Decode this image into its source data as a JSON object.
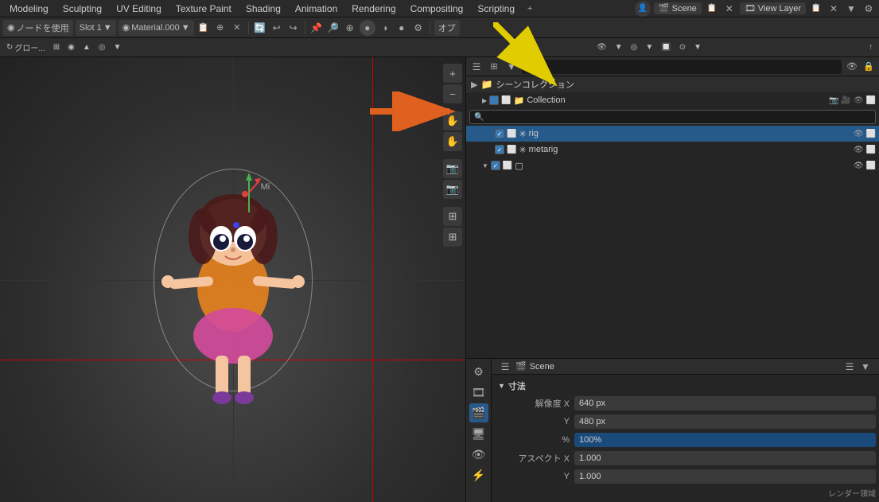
{
  "topMenu": {
    "items": [
      {
        "label": "Modeling",
        "id": "modeling"
      },
      {
        "label": "Sculpting",
        "id": "sculpting"
      },
      {
        "label": "UV Editing",
        "id": "uv-editing"
      },
      {
        "label": "Texture Paint",
        "id": "texture-paint"
      },
      {
        "label": "Shading",
        "id": "shading"
      },
      {
        "label": "Animation",
        "id": "animation"
      },
      {
        "label": "Rendering",
        "id": "rendering"
      },
      {
        "label": "Compositing",
        "id": "compositing"
      },
      {
        "label": "Scripting",
        "id": "scripting"
      }
    ],
    "plusLabel": "+",
    "scene": "Scene",
    "viewLayer": "View Layer"
  },
  "toolbar2": {
    "nodesLabel": "ノードを使用",
    "slotLabel": "Slot 1",
    "materialLabel": "Material.000",
    "opLabel": "オプ"
  },
  "toolbar3": {
    "glowLabel": "グロー...",
    "items": []
  },
  "outliner": {
    "sceneCollectionLabel": "シーンコレクション",
    "collectionLabel": "Collection",
    "searchPlaceholder": "",
    "items": [
      {
        "label": "rig",
        "indent": 2,
        "selected": true,
        "icon": "✳"
      },
      {
        "label": "metarig",
        "indent": 2,
        "selected": false,
        "icon": "✳"
      },
      {
        "label": "",
        "indent": 3,
        "selected": false,
        "icon": "▢"
      }
    ]
  },
  "properties": {
    "headerLabel": "Scene",
    "sectionLabel": "寸法",
    "fields": [
      {
        "label": "解像度 X",
        "value": "640 px",
        "isBlue": false
      },
      {
        "label": "Y",
        "value": "480 px",
        "isBlue": false
      },
      {
        "label": "%",
        "value": "100%",
        "isBlue": true
      },
      {
        "label": "アスペクト X",
        "value": "1.000",
        "isBlue": false
      },
      {
        "label": "Y",
        "value": "1.000",
        "isBlue": false
      }
    ],
    "renderRegionLabel": "レンダー領域"
  },
  "icons": {
    "search": "🔍",
    "eye": "👁",
    "camera": "📷",
    "scene": "🎬",
    "gear": "⚙",
    "plus": "+",
    "minus": "-",
    "grab": "✋",
    "zoom": "🔍",
    "grid": "⊞",
    "triangle_right": "▶",
    "triangle_down": "▼",
    "check": "✓",
    "collection": "📁",
    "render": "📷",
    "output": "🖥",
    "view": "🎞",
    "particle": "✦",
    "physics": "⚡",
    "constraint": "🔗",
    "data": "△",
    "material": "◉",
    "world": "🌐",
    "scene_prop": "🎬",
    "renderprop": "📷"
  },
  "colors": {
    "accent": "#265a8a",
    "highlight": "#3a7ab5",
    "bg_main": "#1e1e1e",
    "bg_panel": "#252525",
    "bg_header": "#2d2d2d",
    "bg_input": "#3a3a3a",
    "text_normal": "#cccccc",
    "text_dim": "#888888",
    "blue_fill": "#1a4a7a",
    "selected_row": "#265a8a"
  }
}
